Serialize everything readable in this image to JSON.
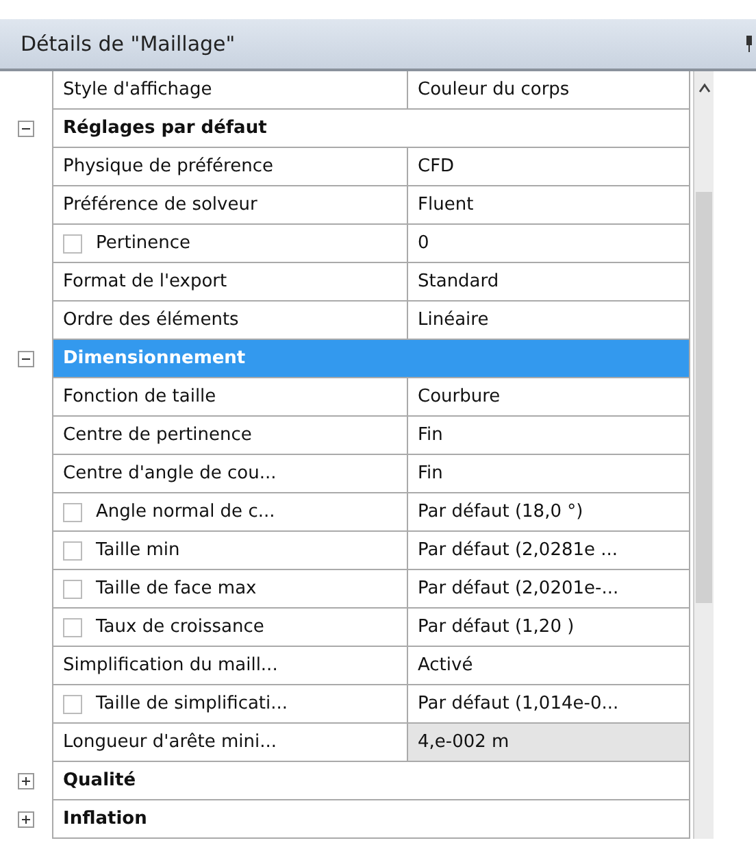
{
  "panel": {
    "title": "Détails de \"Maillage\""
  },
  "rows": [
    {
      "kind": "property",
      "name": "Style d'affichage",
      "value": "Couleur du corps"
    },
    {
      "kind": "group",
      "label": "Réglages par défaut",
      "expanded": true,
      "selected": false,
      "children": [
        {
          "kind": "property",
          "name": "Physique de préférence",
          "value": "CFD"
        },
        {
          "kind": "property",
          "name": "Préférence de solveur",
          "value": "Fluent"
        },
        {
          "kind": "property",
          "name": "Pertinence",
          "value": "0",
          "checked": false
        },
        {
          "kind": "property",
          "name": "Format de l'export",
          "value": "Standard"
        },
        {
          "kind": "property",
          "name": "Ordre des éléments",
          "value": "Linéaire"
        }
      ]
    },
    {
      "kind": "group",
      "label": "Dimensionnement",
      "expanded": true,
      "selected": true,
      "children": [
        {
          "kind": "property",
          "name": "Fonction de taille",
          "value": "Courbure"
        },
        {
          "kind": "property",
          "name": "Centre de pertinence",
          "value": "Fin"
        },
        {
          "kind": "property",
          "name": "Centre d'angle de cou...",
          "value": "Fin"
        },
        {
          "kind": "property",
          "name": "Angle normal de c...",
          "value": "Par défaut (18,0 °)",
          "checked": false
        },
        {
          "kind": "property",
          "name": "Taille min",
          "value": "Par défaut (2,0281e ...",
          "checked": false
        },
        {
          "kind": "property",
          "name": "Taille de face max",
          "value": "Par défaut (2,0201e-...",
          "checked": false
        },
        {
          "kind": "property",
          "name": "Taux de croissance",
          "value": "Par défaut (1,20 )",
          "checked": false
        },
        {
          "kind": "property",
          "name": "Simplification du maill...",
          "value": "Activé"
        },
        {
          "kind": "property",
          "name": "Taille de simplificati...",
          "value": "Par défaut (1,014e-0...",
          "checked": false
        },
        {
          "kind": "property",
          "name": "Longueur d'arête mini...",
          "value": "4,e-002 m",
          "readonly": true
        }
      ]
    },
    {
      "kind": "group",
      "label": "Qualité",
      "expanded": false,
      "selected": false,
      "children": []
    },
    {
      "kind": "group",
      "label": "Inflation",
      "expanded": false,
      "selected": false,
      "children": []
    }
  ]
}
